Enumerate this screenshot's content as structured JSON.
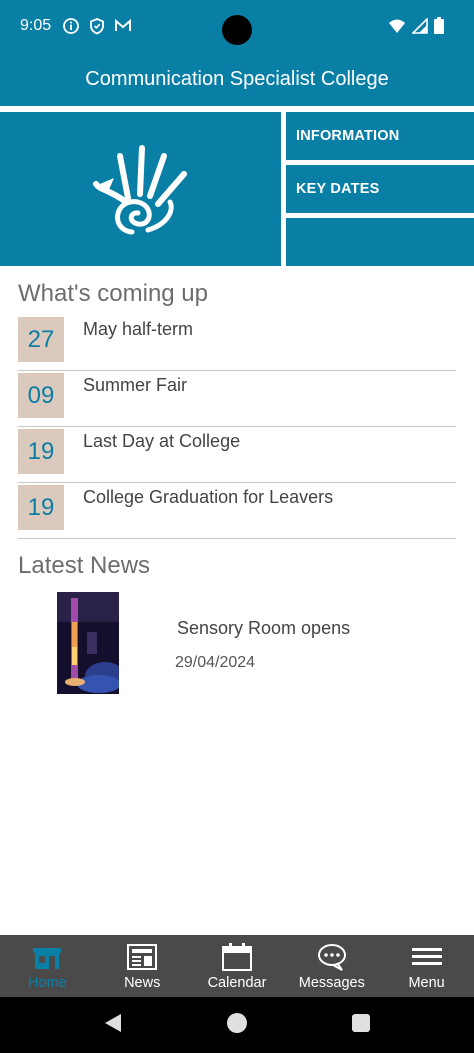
{
  "status_bar": {
    "time": "9:05",
    "left_icons": [
      "info-icon",
      "shield-icon",
      "gmail-icon"
    ],
    "right_icons": [
      "wifi-icon",
      "signal-icon",
      "battery-icon"
    ]
  },
  "header": {
    "title": "Communication Specialist College"
  },
  "hero": {
    "logo": "college-hand-logo",
    "links": [
      {
        "label": "INFORMATION"
      },
      {
        "label": "KEY DATES"
      },
      {
        "label": ""
      }
    ]
  },
  "events": {
    "title": "What's coming up",
    "items": [
      {
        "day": "27",
        "name": "May half-term"
      },
      {
        "day": "09",
        "name": "Summer Fair"
      },
      {
        "day": "19",
        "name": "Last Day at College"
      },
      {
        "day": "19",
        "name": "College Graduation for Leavers"
      }
    ]
  },
  "news": {
    "title": "Latest News",
    "items": [
      {
        "title": "Sensory Room opens",
        "date": "29/04/2024",
        "image": "sensory-room-photo"
      }
    ]
  },
  "bottom_nav": {
    "items": [
      {
        "label": "Home",
        "icon": "home-icon",
        "active": true
      },
      {
        "label": "News",
        "icon": "news-icon",
        "active": false
      },
      {
        "label": "Calendar",
        "icon": "calendar-icon",
        "active": false
      },
      {
        "label": "Messages",
        "icon": "messages-icon",
        "active": false
      },
      {
        "label": "Menu",
        "icon": "menu-icon",
        "active": false
      }
    ]
  },
  "colors": {
    "brand": "#0a7fa6",
    "date_tile": "#dcc9bd",
    "nav_background": "#4a4a4a"
  }
}
